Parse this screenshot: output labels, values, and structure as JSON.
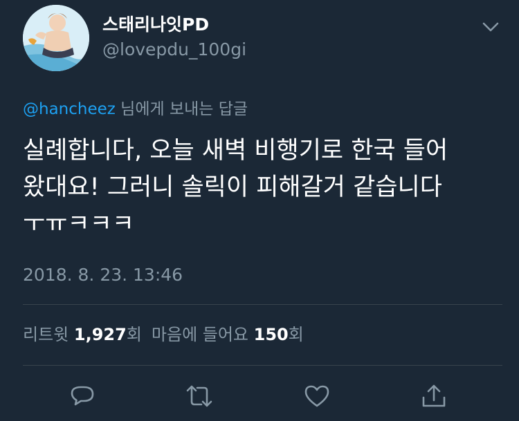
{
  "user": {
    "display_name": "스태리나잇PD",
    "handle": "@lovepdu_100gi"
  },
  "reply": {
    "mention": "@hancheez",
    "suffix": " 님에게 보내는 답글"
  },
  "tweet": {
    "lines": [
      "실례합니다, 오늘 새벽 비행기로 한국 들어",
      "왔대요! 그러니 솔릭이 피해갈거 같습니다",
      "ㅜㅠㅋㅋㅋ"
    ],
    "timestamp": "2018. 8. 23. 13:46"
  },
  "stats": {
    "retweet_label": "리트윗",
    "retweet_count": "1,927",
    "retweet_unit": "회",
    "like_label": "마음에 들어요",
    "like_count": "150",
    "like_unit": "회"
  },
  "colors": {
    "background": "#1b2836",
    "mention": "#1da1f2",
    "muted": "#8899a6",
    "divider": "#38444d"
  },
  "icons": [
    "chevron-down-icon",
    "reply-icon",
    "retweet-icon",
    "like-icon",
    "share-icon"
  ]
}
